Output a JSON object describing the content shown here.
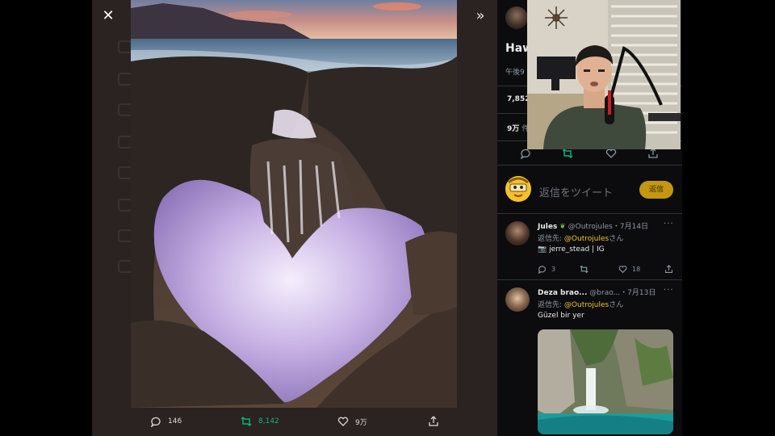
{
  "viewer": {
    "close_icon": "close-icon",
    "expand_icon": "double-chevron-right-icon",
    "photo_description_icon": "landscape-photo",
    "actions": {
      "replies": "146",
      "retweets": "8,142",
      "likes": "9万"
    }
  },
  "panel": {
    "title": "Haw",
    "time": "午後9",
    "stat_retweets": "7,852",
    "stat_likes": "9万",
    "stat_likes_suffix": "件",
    "reply_placeholder": "返信をツイート",
    "reply_button": "返信"
  },
  "tweets": [
    {
      "name": "Jules",
      "handle": "@Outrojules",
      "date": "・7月14日",
      "reply_to_label": "返信先:",
      "reply_to_handle": "@Outrojules",
      "reply_to_suffix": "さん",
      "body": "jerre_stead | IG",
      "replies": "3",
      "likes": "18"
    },
    {
      "name": "Deza brao...",
      "handle": "@brao...",
      "date": "・7月13日",
      "reply_to_label": "返信先:",
      "reply_to_handle": "@Outrojules",
      "reply_to_suffix": "さん",
      "body": "Güzel bir yer"
    }
  ],
  "colors": {
    "accent_green": "#00ba7c",
    "accent_yellow": "#f3c229",
    "panel_bg": "#0c0c0e",
    "frame_bg": "#2b2222"
  }
}
